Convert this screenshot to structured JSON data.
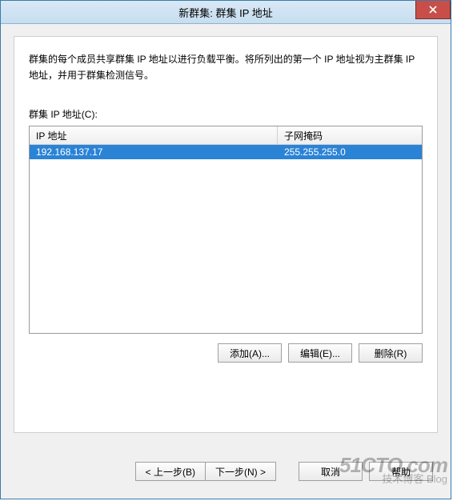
{
  "window": {
    "title": "新群集: 群集 IP 地址"
  },
  "description": "群集的每个成员共享群集 IP 地址以进行负载平衡。将所列出的第一个 IP 地址视为主群集 IP 地址，并用于群集检测信号。",
  "list_label": "群集 IP 地址(C):",
  "columns": {
    "ip": "IP 地址",
    "mask": "子网掩码"
  },
  "rows": [
    {
      "ip": "192.168.137.17",
      "mask": "255.255.255.0",
      "selected": true
    }
  ],
  "buttons": {
    "add": "添加(A)...",
    "edit": "编辑(E)...",
    "remove": "删除(R)"
  },
  "wizard": {
    "back": "< 上一步(B)",
    "next": "下一步(N) >",
    "cancel": "取消",
    "help": "帮助"
  },
  "watermark": {
    "line1": "51CTO.com",
    "line2": "技术博客 Blog"
  }
}
